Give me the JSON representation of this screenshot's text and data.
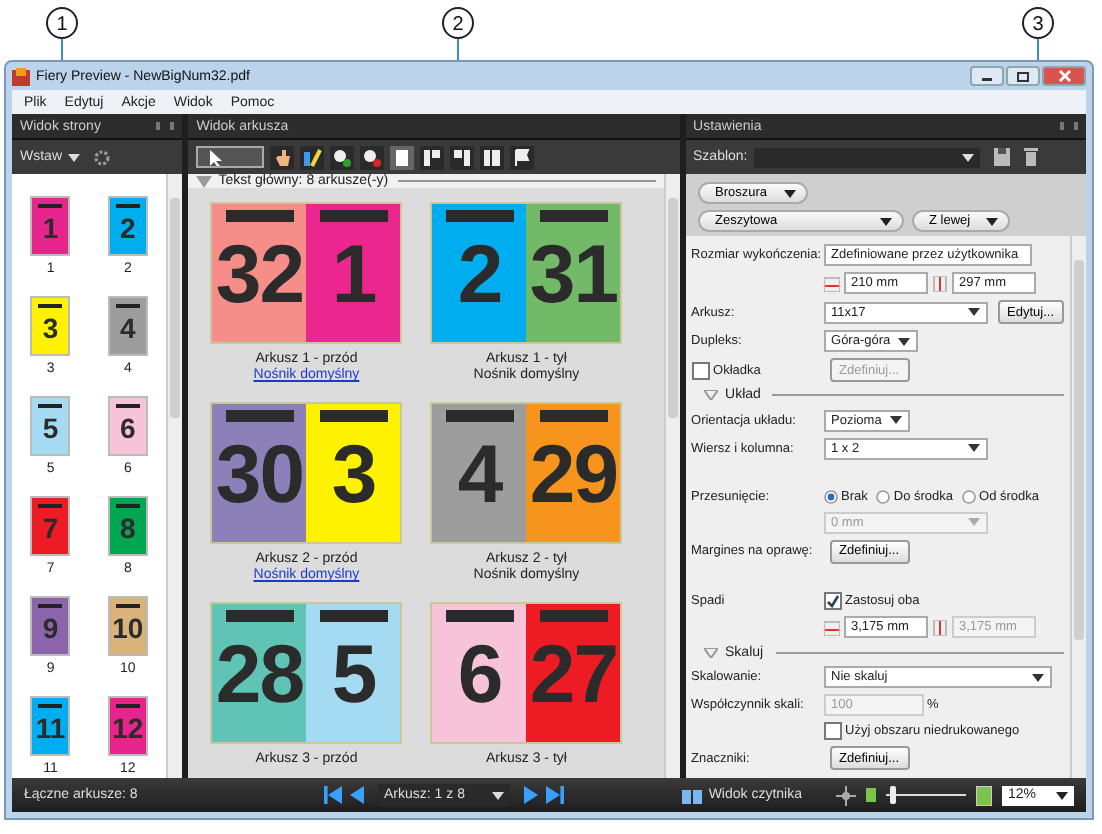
{
  "callouts": [
    "1",
    "2",
    "3"
  ],
  "window": {
    "title": "Fiery Preview - NewBigNum32.pdf"
  },
  "menu": [
    "Plik",
    "Edytuj",
    "Akcje",
    "Widok",
    "Pomoc"
  ],
  "page_view": {
    "title": "Widok strony",
    "insert_button": "Wstaw",
    "pages": [
      {
        "number": "1",
        "label": "1",
        "color": "#e6258c"
      },
      {
        "number": "2",
        "label": "2",
        "color": "#00aeef"
      },
      {
        "number": "3",
        "label": "3",
        "color": "#fff200"
      },
      {
        "number": "4",
        "label": "4",
        "color": "#9d9d9d"
      },
      {
        "number": "5",
        "label": "5",
        "color": "#a5daf3"
      },
      {
        "number": "6",
        "label": "6",
        "color": "#f7c3d8"
      },
      {
        "number": "7",
        "label": "7",
        "color": "#ed1c24"
      },
      {
        "number": "8",
        "label": "8",
        "color": "#00a650"
      },
      {
        "number": "9",
        "label": "9",
        "color": "#8c64ab"
      },
      {
        "number": "10",
        "label": "10",
        "color": "#d9b27c"
      },
      {
        "number": "11",
        "label": "11",
        "color": "#00aeef"
      },
      {
        "number": "12",
        "label": "12",
        "color": "#e6258c"
      }
    ]
  },
  "sheet_view": {
    "title": "Widok arkusza",
    "section": "Tekst główny: 8 arkusze(-y)",
    "sheets": [
      {
        "pages": [
          {
            "number": "32",
            "color": "#f58d88"
          },
          {
            "number": "1",
            "color": "#ec268f"
          }
        ],
        "caption": "Arkusz 1 - przód",
        "media": "Nośnik domyślny",
        "media_link": true
      },
      {
        "pages": [
          {
            "number": "2",
            "color": "#00aeef"
          },
          {
            "number": "31",
            "color": "#72b968"
          }
        ],
        "caption": "Arkusz 1 - tył",
        "media": "Nośnik domyślny",
        "media_link": false
      },
      {
        "pages": [
          {
            "number": "30",
            "color": "#8b80b8"
          },
          {
            "number": "3",
            "color": "#fff200"
          }
        ],
        "caption": "Arkusz 2 - przód",
        "media": "Nośnik domyślny",
        "media_link": true
      },
      {
        "pages": [
          {
            "number": "4",
            "color": "#9d9d9d"
          },
          {
            "number": "29",
            "color": "#f7941d"
          }
        ],
        "caption": "Arkusz 2 - tył",
        "media": "Nośnik domyślny",
        "media_link": false
      },
      {
        "pages": [
          {
            "number": "28",
            "color": "#5fc3b5"
          },
          {
            "number": "5",
            "color": "#a5daf3"
          }
        ],
        "caption": "Arkusz 3 - przód"
      },
      {
        "pages": [
          {
            "number": "6",
            "color": "#f7c3d8"
          },
          {
            "number": "27",
            "color": "#ed1c24"
          }
        ],
        "caption": "Arkusz 3 - tył"
      }
    ]
  },
  "settings": {
    "title": "Ustawienia",
    "template_label": "Szablon:",
    "binding": "Broszura",
    "type": "Zeszytowa",
    "side": "Z lewej",
    "finish_label": "Rozmiar wykończenia:",
    "finish_value": "Zdefiniowane przez użytkownika",
    "width": "210 mm",
    "height": "297 mm",
    "sheet_label": "Arkusz:",
    "sheet_value": "11x17",
    "edit_button": "Edytuj...",
    "duplex_label": "Dupleks:",
    "duplex_value": "Góra-góra",
    "cover": {
      "label": "Okładka",
      "checked": false
    },
    "cover_button": {
      "label": "Zdefiniuj...",
      "disabled": true
    },
    "layout_section": "Układ",
    "orientation_label": "Orientacja układu:",
    "orientation_value": "Pozioma",
    "rows_label": "Wiersz i kolumna:",
    "rows_value": "1 x 2",
    "shift_label": "Przesunięcie:",
    "shift_options": [
      {
        "label": "Brak",
        "selected": true
      },
      {
        "label": "Do środka",
        "selected": false
      },
      {
        "label": "Od środka",
        "selected": false
      }
    ],
    "shift_amount": {
      "value": "0 mm",
      "disabled": true
    },
    "gutter_label": "Margines na oprawę:",
    "gutter_button": "Zdefiniuj...",
    "bleed_label": "Spadi",
    "bleed_both": {
      "label": "Zastosuj oba",
      "checked": true
    },
    "bleed_width": {
      "value": "3,175 mm",
      "disabled": false
    },
    "bleed_height": {
      "value": "3,175 mm",
      "disabled": true
    },
    "scale_section": "Skaluj",
    "scaling_label": "Skalowanie:",
    "scaling_value": "Nie skaluj",
    "factor_label": "Współczynnik skali:",
    "factor": {
      "value": "100",
      "disabled": true
    },
    "factor_unit": "%",
    "nonprint": {
      "label": "Użyj obszaru niedrukowanego",
      "checked": false
    },
    "marks_label": "Znaczniki:",
    "marks_button": "Zdefiniuj..."
  },
  "status_bar": {
    "total": "Łączne arkusze: 8",
    "sheet_select": "Arkusz: 1 z 8",
    "reader_view": "Widok czytnika",
    "zoom": {
      "level": 0.05,
      "value": "12%"
    }
  }
}
